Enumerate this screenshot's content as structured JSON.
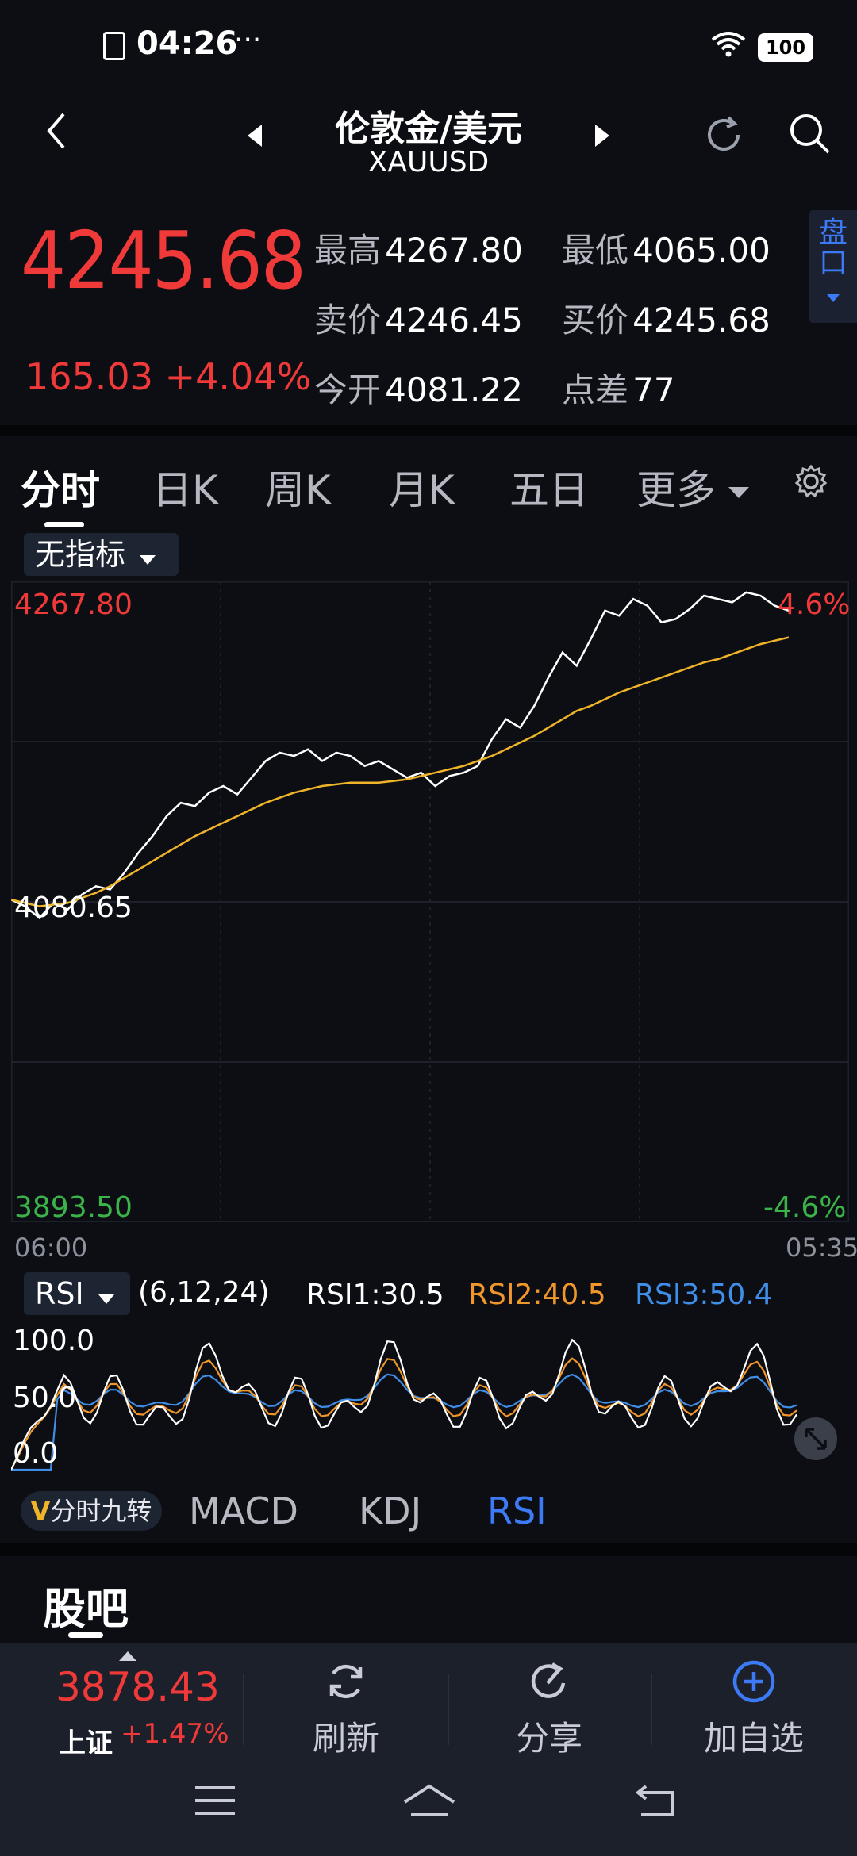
{
  "status_bar": {
    "time": "04:26",
    "dots": "···",
    "battery": "100"
  },
  "header": {
    "title": "伦敦金/美元",
    "symbol": "XAUUSD"
  },
  "quote": {
    "price": "4245.68",
    "change": "165.03",
    "change_pct": "+4.04%",
    "high_label": "最高",
    "high": "4267.80",
    "low_label": "最低",
    "low": "4065.00",
    "sell_label": "卖价",
    "sell": "4246.45",
    "buy_label": "买价",
    "buy": "4245.68",
    "open_label": "今开",
    "open": "4081.22",
    "spread_label": "点差",
    "spread": "77",
    "pankou": "盘口"
  },
  "tabs": [
    "分时",
    "日K",
    "周K",
    "月K",
    "五日",
    "更多"
  ],
  "indicator_select": "无指标",
  "chart_labels": {
    "top_price": "4267.80",
    "mid_price": "4080.65",
    "bottom_price": "3893.50",
    "top_pct": "4.6%",
    "bottom_pct": "-4.6%",
    "time_start": "06:00",
    "time_end": "05:35"
  },
  "rsi": {
    "select": "RSI",
    "params": "(6,12,24)",
    "rsi1": "RSI1:30.5",
    "rsi2": "RSI2:40.5",
    "rsi3": "RSI3:50.4",
    "axis": [
      "100.0",
      "50.0",
      "0.0"
    ]
  },
  "indicator_tabs": {
    "nine": "分时九转",
    "macd": "MACD",
    "kdj": "KDJ",
    "rsi": "RSI"
  },
  "section_title": "股吧",
  "bottom_bar": {
    "index_price": "3878.43",
    "index_name": "上证",
    "index_change": "+1.47%",
    "refresh": "刷新",
    "share": "分享",
    "add": "加自选"
  },
  "colors": {
    "up": "#f03a3a",
    "down": "#3bb34a",
    "accent": "#3d7af5",
    "avg_line": "#f0b429",
    "rsi2": "#f0962a",
    "rsi3": "#3f8ee8"
  },
  "chart_data": {
    "type": "line",
    "x_range": [
      "06:00",
      "05:35"
    ],
    "ylim": [
      3893.5,
      4267.8
    ],
    "reference": 4080.65,
    "series": [
      {
        "values": [
          4082,
          4078,
          4071,
          4080,
          4076,
          4085,
          4090,
          4088,
          4098,
          4110,
          4120,
          4132,
          4140,
          4138,
          4146,
          4150,
          4145,
          4155,
          4165,
          4170,
          4168,
          4172,
          4165,
          4170,
          4168,
          4162,
          4165,
          4160,
          4155,
          4158,
          4150,
          4156,
          4158,
          4162,
          4178,
          4190,
          4185,
          4198,
          4215,
          4230,
          4222,
          4238,
          4255,
          4252,
          4262,
          4258,
          4248,
          4250,
          4256,
          4264,
          4262,
          4260,
          4266,
          4264,
          4258,
          4255
        ]
      },
      {
        "values": [
          4082,
          4080,
          4078,
          4079,
          4080,
          4083,
          4086,
          4090,
          4095,
          4100,
          4105,
          4110,
          4115,
          4120,
          4124,
          4128,
          4132,
          4136,
          4140,
          4143,
          4146,
          4148,
          4150,
          4151,
          4152,
          4152,
          4152,
          4153,
          4154,
          4156,
          4158,
          4160,
          4162,
          4165,
          4168,
          4172,
          4176,
          4180,
          4185,
          4190,
          4195,
          4198,
          4202,
          4206,
          4209,
          4212,
          4215,
          4218,
          4221,
          4224,
          4226,
          4229,
          4232,
          4235,
          4237,
          4239
        ]
      }
    ]
  }
}
